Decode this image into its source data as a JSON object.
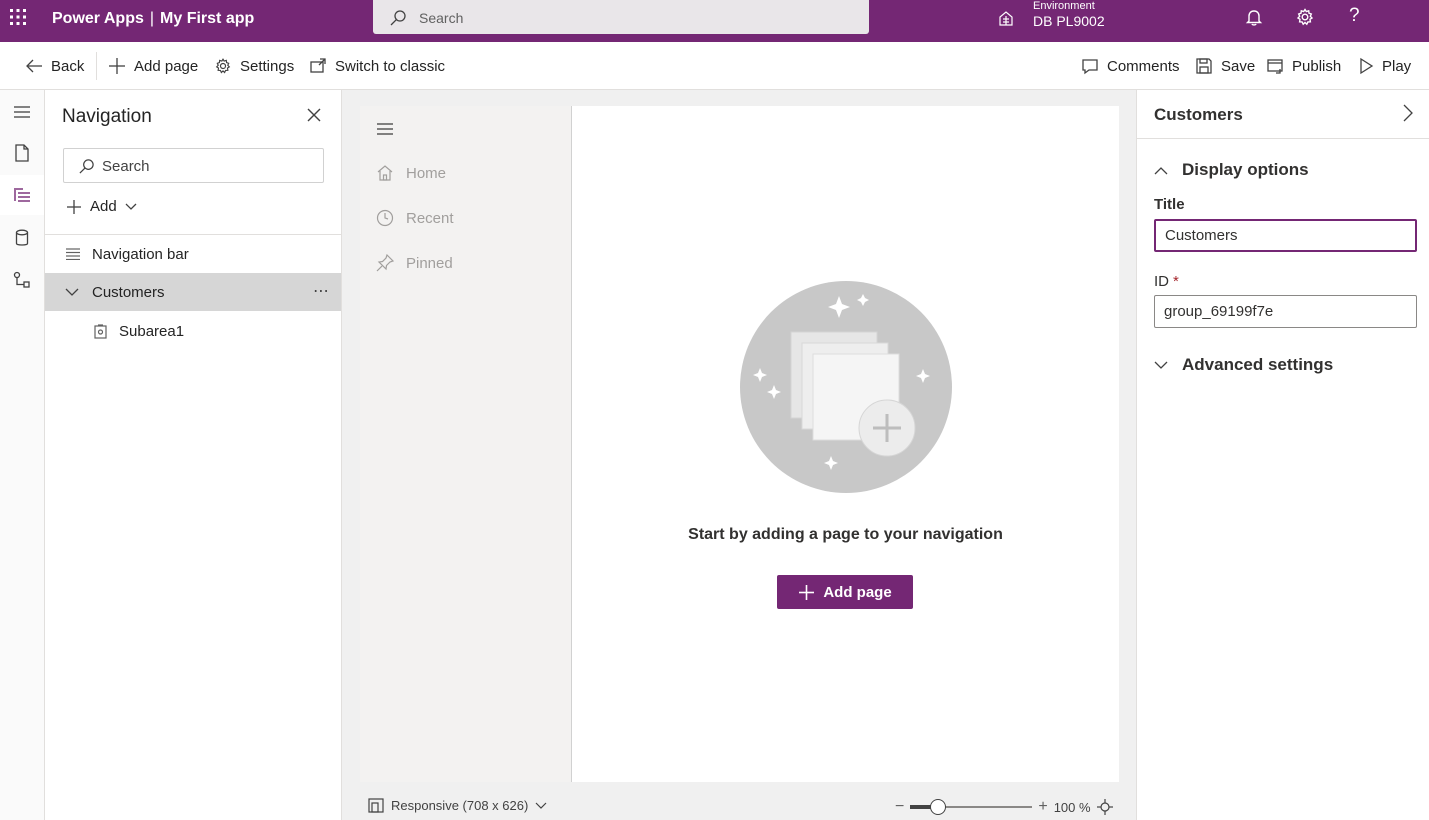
{
  "topbar": {
    "app_name": "Power Apps",
    "app_separator": "|",
    "app_title": "My First app",
    "search_placeholder": "Search",
    "environment_label": "Environment",
    "environment_name": "DB PL9002",
    "help_glyph": "?",
    "background_color": "#742774"
  },
  "commandbar": {
    "back": "Back",
    "add_page": "Add page",
    "settings": "Settings",
    "switch_classic": "Switch to classic",
    "comments": "Comments",
    "save": "Save",
    "publish": "Publish",
    "play": "Play"
  },
  "rail": {
    "items": [
      "hamburger-icon",
      "page-icon",
      "tree-view-icon",
      "data-icon",
      "flow-icon"
    ],
    "active": "tree-view-icon"
  },
  "navigation": {
    "title": "Navigation",
    "search_placeholder": "Search",
    "add_label": "Add",
    "tree": {
      "navbar_label": "Navigation bar",
      "group_label": "Customers",
      "group_more": "⋯",
      "subarea_label": "Subarea1"
    }
  },
  "preview": {
    "sitemap": {
      "items": [
        {
          "label": "Home",
          "icon": "home-icon"
        },
        {
          "label": "Recent",
          "icon": "clock-icon"
        },
        {
          "label": "Pinned",
          "icon": "pin-icon"
        }
      ]
    },
    "empty_message": "Start by adding a page to your navigation",
    "add_page_button": "Add page"
  },
  "statusbar": {
    "responsive_label": "Responsive (708 x 626)",
    "zoom_level": "100 %",
    "zoom_minus": "−",
    "zoom_plus": "+",
    "zoom_fraction": 0.23
  },
  "properties": {
    "title": "Customers",
    "display_options": "Display options",
    "title_label": "Title",
    "title_value": "Customers",
    "id_label": "ID",
    "id_required": "*",
    "id_value": "group_69199f7e",
    "advanced_settings": "Advanced settings"
  }
}
